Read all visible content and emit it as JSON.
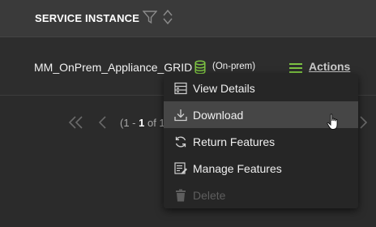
{
  "table": {
    "column_header": "SERVICE INSTANCE",
    "row": {
      "instance_name": "MM_OnPrem_Appliance_GRID",
      "environment": "(On-prem)",
      "actions_label": "Actions"
    }
  },
  "pager": {
    "range_prefix": "(1 - ",
    "range_end": "1",
    "range_suffix": " of 1"
  },
  "menu": {
    "items": [
      {
        "label": "View Details",
        "icon": "details-icon",
        "state": "normal"
      },
      {
        "label": "Download",
        "icon": "download-icon",
        "state": "hover"
      },
      {
        "label": "Return Features",
        "icon": "return-icon",
        "state": "normal"
      },
      {
        "label": "Manage Features",
        "icon": "manage-icon",
        "state": "normal"
      },
      {
        "label": "Delete",
        "icon": "trash-icon",
        "state": "disabled"
      }
    ]
  },
  "colors": {
    "background": "#2b2b2b",
    "header": "#3a3a3a",
    "menu": "#262626",
    "menu_hover": "#464646",
    "accent_green": "#7cc242"
  }
}
